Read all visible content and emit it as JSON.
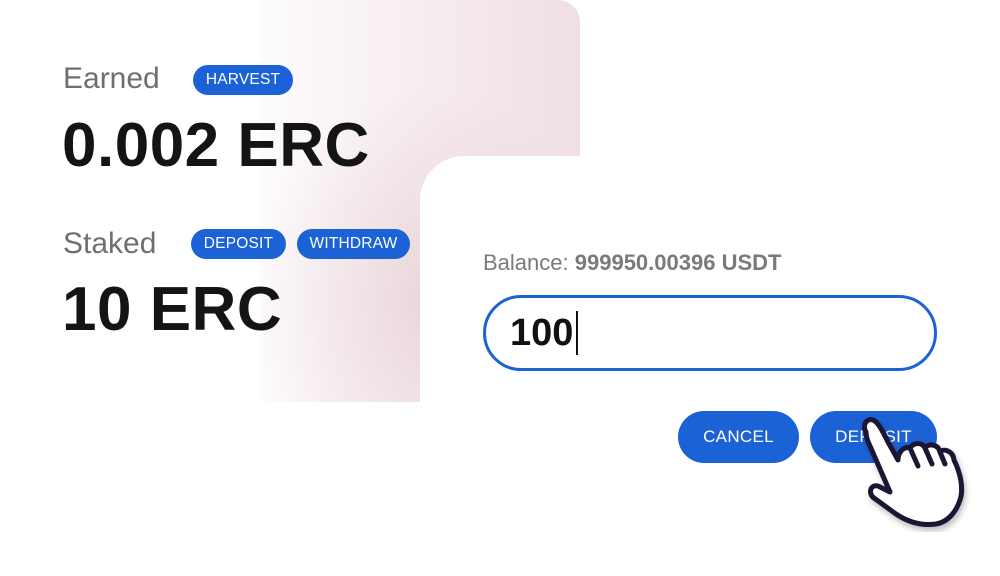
{
  "earned": {
    "label": "Earned",
    "value": "0.002 ERC",
    "harvest_button": "HARVEST"
  },
  "staked": {
    "label": "Staked",
    "value": "10 ERC",
    "deposit_button": "DEPOSIT",
    "withdraw_button": "WITHDRAW"
  },
  "modal": {
    "balance_label": "Balance:",
    "balance_value": "999950.00396 USDT",
    "amount_value": "100",
    "cancel_button": "CANCEL",
    "deposit_button": "DEPOSIT"
  },
  "icons": {
    "cursor": "pointing-hand-icon"
  },
  "colors": {
    "accent": "#1b62d6",
    "heading_text": "#141414",
    "label_text": "#6f6f6f"
  }
}
